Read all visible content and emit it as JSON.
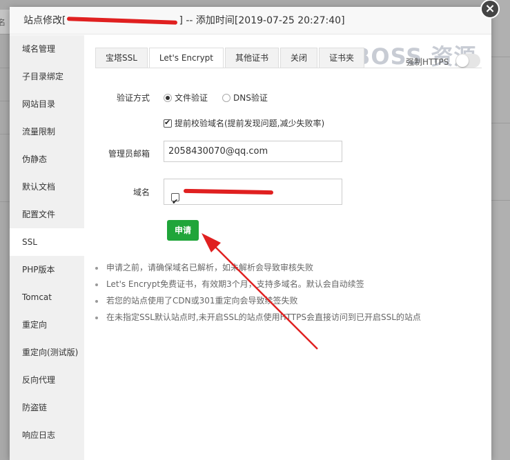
{
  "background": {
    "left_label": "反名"
  },
  "dialog": {
    "title_prefix": "站点修改[",
    "title_suffix": "] -- 添加时间[2019-07-25 20:27:40]",
    "close_glyph": "×"
  },
  "sidebar": {
    "items": [
      {
        "label": "域名管理"
      },
      {
        "label": "子目录绑定"
      },
      {
        "label": "网站目录"
      },
      {
        "label": "流量限制"
      },
      {
        "label": "伪静态"
      },
      {
        "label": "默认文档"
      },
      {
        "label": "配置文件"
      },
      {
        "label": "SSL"
      },
      {
        "label": "PHP版本"
      },
      {
        "label": "Tomcat"
      },
      {
        "label": "重定向"
      },
      {
        "label": "重定向(测试版)"
      },
      {
        "label": "反向代理"
      },
      {
        "label": "防盗链"
      },
      {
        "label": "响应日志"
      }
    ],
    "active": "SSL"
  },
  "tabs": [
    {
      "label": "宝塔SSL"
    },
    {
      "label": "Let's Encrypt"
    },
    {
      "label": "其他证书"
    },
    {
      "label": "关闭"
    },
    {
      "label": "证书夹"
    }
  ],
  "active_tab": "Let's Encrypt",
  "watermark": "BOSS 资源",
  "force_https": {
    "label": "强制HTTPS",
    "enabled": false
  },
  "form": {
    "verify_label": "验证方式",
    "verify_options": [
      "文件验证",
      "DNS验证"
    ],
    "verify_selected": "文件验证",
    "precheck_label": "提前校验域名(提前发现问题,减少失败率)",
    "precheck_checked": true,
    "email_label": "管理员邮箱",
    "email_value": "2058430070@qq.com",
    "domain_label": "域名",
    "domain_checked": true,
    "apply_label": "申请"
  },
  "notes": [
    "申请之前，请确保域名已解析，如未解析会导致审核失败",
    "Let's Encrypt免费证书，有效期3个月，支持多域名。默认会自动续签",
    "若您的站点使用了CDN或301重定向会导致续签失败",
    "在未指定SSL默认站点时,未开启SSL的站点使用HTTPS会直接访问到已开启SSL的站点"
  ],
  "colors": {
    "accent_green": "#20a53a",
    "annotation_red": "#e02020"
  }
}
